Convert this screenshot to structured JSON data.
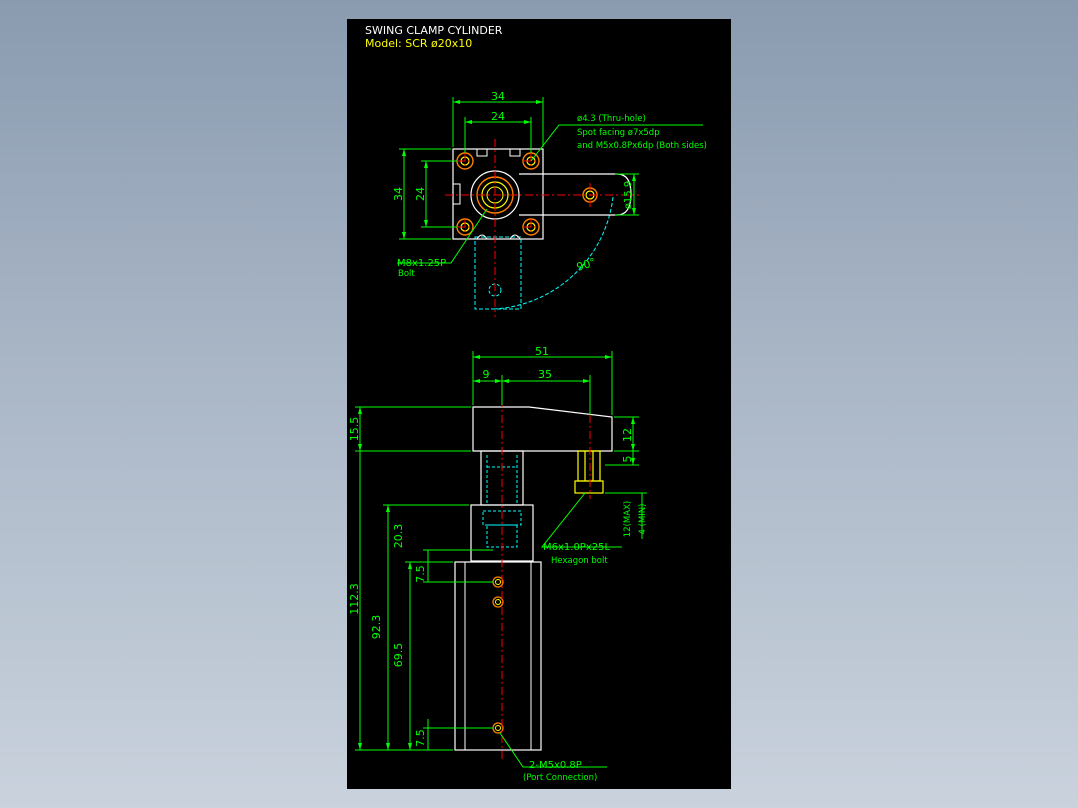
{
  "title": {
    "line1": "SWING CLAMP CYLINDER",
    "line2": "Model: SCR ø20x10"
  },
  "top_view": {
    "dims": {
      "w_outer": "34",
      "w_inner": "24",
      "h_outer": "34",
      "h_inner": "24",
      "arm_dia": "ø15.9",
      "angle": "90°"
    },
    "notes": {
      "thru_hole": "ø4.3 (Thru-hole)",
      "spot_facing": "Spot facing ø7x5dp",
      "tap": "and M5x0.8Px6dp (Both sides)",
      "bolt_size": "M8x1.25P",
      "bolt_label": "Bolt"
    }
  },
  "side_view": {
    "dims": {
      "total_width": "51",
      "offset": "9",
      "arm_reach": "35",
      "arm_height": "15.5",
      "arm_thick": "12",
      "bolt_gap": "5",
      "stroke_max": "12(MAX)",
      "stroke_min": "4 (MIN)",
      "rod_len": "20.3",
      "total_height": "112.3",
      "body_height": "92.3",
      "port_pitch": "69.5",
      "port_top": "7.5",
      "port_bottom": "7.5"
    },
    "notes": {
      "hex_bolt_size": "M6x1.0Px25L",
      "hex_bolt_label": "Hexagon bolt",
      "port_size": "2-M5x0.8P",
      "port_label": "(Port Connection)"
    }
  },
  "colors": {
    "background": "#000000",
    "outline": "#ffffff",
    "dimension": "#00ff00",
    "centerline": "#ff0000",
    "hidden": "#00ffff",
    "hole": "#ffff00",
    "hole_ring": "#ff8000"
  }
}
